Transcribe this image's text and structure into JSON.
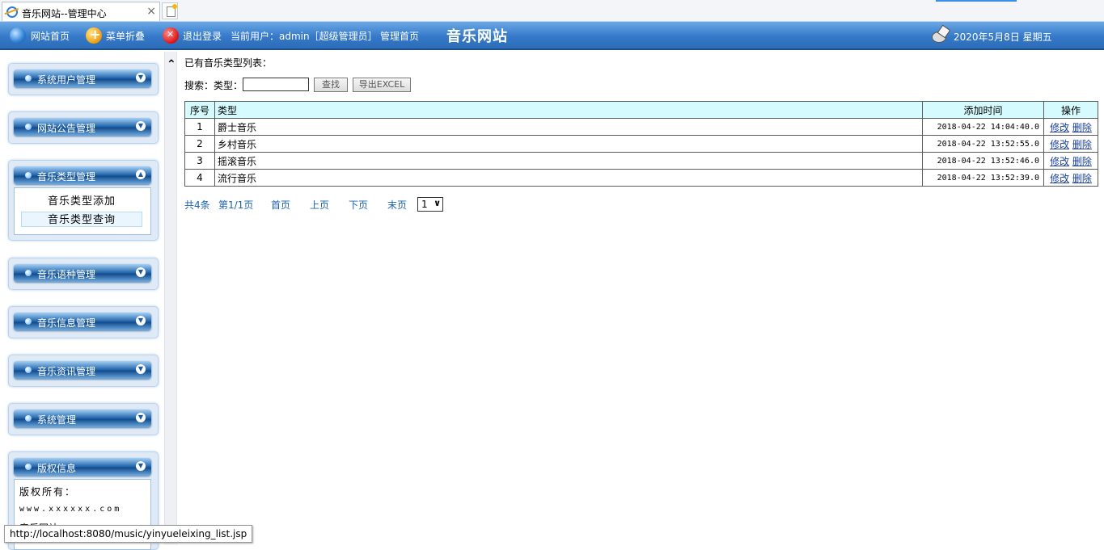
{
  "browser": {
    "tab_title": "音乐网站--管理中心",
    "close_glyph": "×",
    "status_url": "http://localhost:8080/music/yinyueleixing_list.jsp"
  },
  "header": {
    "home_label": "网站首页",
    "fold_label": "菜单折叠",
    "logout_label": "退出登录",
    "current_user": "当前用户：admin［超级管理员］",
    "admin_home_label": "管理首页",
    "site_name": "音乐网站",
    "date": "2020年5月8日 星期五"
  },
  "sidebar": {
    "menus": [
      {
        "label": "系统用户管理"
      },
      {
        "label": "网站公告管理"
      },
      {
        "label": "音乐类型管理",
        "items": [
          "音乐类型添加",
          "音乐类型查询"
        ]
      },
      {
        "label": "音乐语种管理"
      },
      {
        "label": "音乐信息管理"
      },
      {
        "label": "音乐资讯管理"
      },
      {
        "label": "系统管理"
      },
      {
        "label": "版权信息",
        "copyright_label": "版权所有：",
        "site": "www.xxxxxx.com",
        "extra": "音乐网站"
      }
    ]
  },
  "content": {
    "list_title": "已有音乐类型列表：",
    "search_label": "搜索：类型：",
    "search_value": "",
    "search_button": "查找",
    "export_button": "导出EXCEL",
    "table": {
      "headers": [
        "序号",
        "类型",
        "添加时间",
        "操作"
      ],
      "rows": [
        {
          "no": "1",
          "type": "爵士音乐",
          "time": "2018-04-22 14:04:40.0"
        },
        {
          "no": "2",
          "type": "乡村音乐",
          "time": "2018-04-22 13:52:55.0"
        },
        {
          "no": "3",
          "type": "摇滚音乐",
          "time": "2018-04-22 13:52:46.0"
        },
        {
          "no": "4",
          "type": "流行音乐",
          "time": "2018-04-22 13:52:39.0"
        }
      ],
      "edit_label": "修改",
      "delete_label": "删除"
    },
    "pager": {
      "total": "共4条",
      "page": "第1/1页",
      "first": "首页",
      "prev": "上页",
      "next": "下页",
      "last": "末页",
      "selected": "1"
    }
  },
  "colors": {
    "header_blue": "#3579c9",
    "table_header_bg": "#d5fbff",
    "link_blue": "#1a3f9e"
  }
}
